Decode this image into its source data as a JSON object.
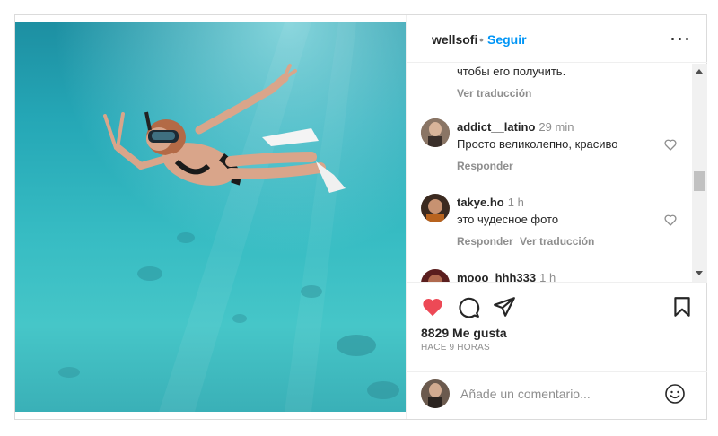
{
  "post": {
    "image_alt": "underwater snorkeling photo"
  },
  "header": {
    "username": "wellsofi",
    "separator": "•",
    "follow_label": "Seguir"
  },
  "comments": {
    "partial": {
      "text": "чтобы его получить.",
      "action": "Ver traducción"
    },
    "items": [
      {
        "user": "addict__latino",
        "time": "29 min",
        "text": "Просто великолепно, красиво",
        "reply": "Responder",
        "translate": ""
      },
      {
        "user": "takye.ho",
        "time": "1 h",
        "text": "это чудесное фото",
        "reply": "Responder",
        "translate": "Ver traducción"
      },
      {
        "user": "mooo_hhh333",
        "time": "1 h",
        "text": "",
        "reply": "",
        "translate": ""
      }
    ]
  },
  "actions": {
    "likes": "8829 Me gusta",
    "time_ago": "HACE 9 HORAS",
    "like_color": "#ed4956"
  },
  "composer": {
    "placeholder": "Añade un comentario..."
  },
  "icons": {
    "like": "heart-filled-icon",
    "comment": "comment-bubble-icon",
    "share": "paper-plane-icon",
    "save": "bookmark-icon",
    "more": "ellipsis-icon",
    "emoji": "smiley-icon"
  }
}
